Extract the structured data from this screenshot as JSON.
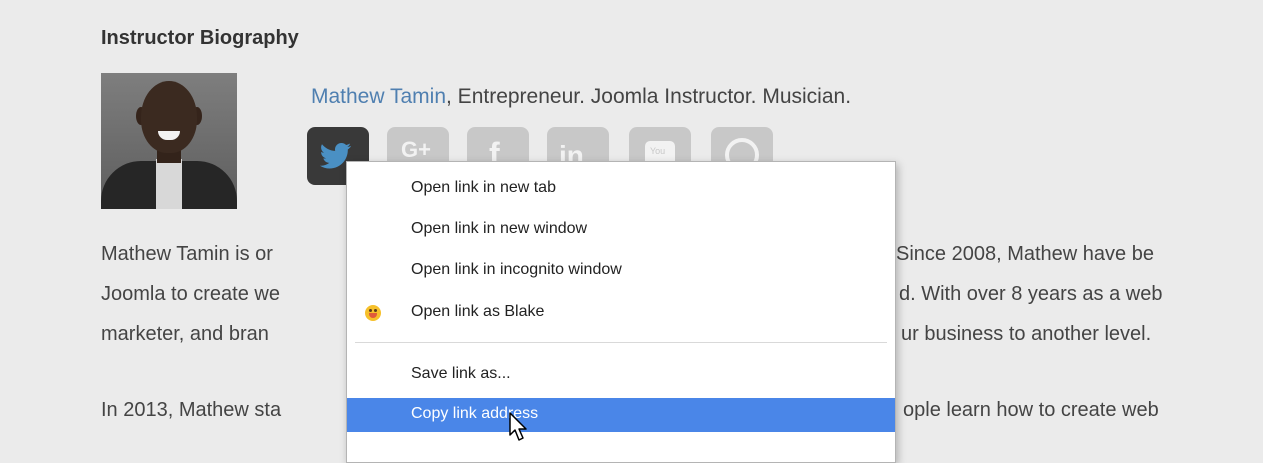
{
  "heading": "Instructor Biography",
  "byline": {
    "name": "Mathew Tamin",
    "rest": ", Entrepreneur. Joomla Instructor. Musician."
  },
  "social_icons": [
    "twitter-icon",
    "google-plus-icon",
    "facebook-icon",
    "linkedin-icon",
    "youtube-icon",
    "website-icon"
  ],
  "paragraph1": {
    "line1_left": "Mathew Tamin is or",
    "line1_right": " Since 2008, Mathew have be",
    "line2_left": "Joomla to create we",
    "line2_right": "d. With over 8 years as a web",
    "line3_left": "marketer, and bran",
    "line3_right": "ur business to another level."
  },
  "paragraph2": {
    "line1_left": "In 2013, Mathew sta",
    "line1_right": "ople learn how to create web"
  },
  "context_menu": {
    "items": [
      "Open link in new tab",
      "Open link in new window",
      "Open link in incognito window",
      "Open link as Blake",
      "Save link as...",
      "Copy link address"
    ]
  },
  "colors": {
    "background": "#ebebeb",
    "link": "#4f7fb0",
    "menu_highlight": "#4a86e8",
    "twitter_active": "#393939",
    "social_inactive": "#c8c8c8"
  }
}
